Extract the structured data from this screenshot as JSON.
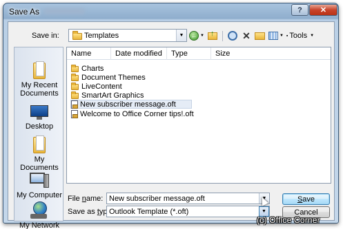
{
  "window": {
    "title": "Save As",
    "help_label": "?",
    "close_label": "✕"
  },
  "save_in": {
    "label": "Save in:",
    "value": "Templates"
  },
  "toolbar": {
    "tools_label": "Tools"
  },
  "places": [
    {
      "label": "My Recent Documents",
      "icon": "recent-documents-icon"
    },
    {
      "label": "Desktop",
      "icon": "desktop-icon"
    },
    {
      "label": "My Documents",
      "icon": "my-documents-icon"
    },
    {
      "label": "My Computer",
      "icon": "computer-icon"
    },
    {
      "label": "My Network Places",
      "icon": "network-places-icon"
    }
  ],
  "columns": [
    "Name",
    "Date modified",
    "Type",
    "Size"
  ],
  "files": [
    {
      "name": "Charts",
      "kind": "folder"
    },
    {
      "name": "Document Themes",
      "kind": "folder"
    },
    {
      "name": "LiveContent",
      "kind": "folder"
    },
    {
      "name": "SmartArt Graphics",
      "kind": "folder"
    },
    {
      "name": "New subscriber message.oft",
      "kind": "template",
      "selected": true
    },
    {
      "name": "Welcome to Office Corner tips!.oft",
      "kind": "template"
    }
  ],
  "file_name": {
    "label_prefix": "File ",
    "label_underlined": "n",
    "label_suffix": "ame:",
    "value": "New subscriber message.oft"
  },
  "save_as_type": {
    "label_prefix": "Save as ",
    "label_underlined": "t",
    "label_suffix": "ype:",
    "value": "Outlook Template (*.oft)"
  },
  "buttons": {
    "save_prefix": "",
    "save_underlined": "S",
    "save_suffix": "ave",
    "cancel": "Cancel"
  },
  "watermark": "(c) Office Corner"
}
